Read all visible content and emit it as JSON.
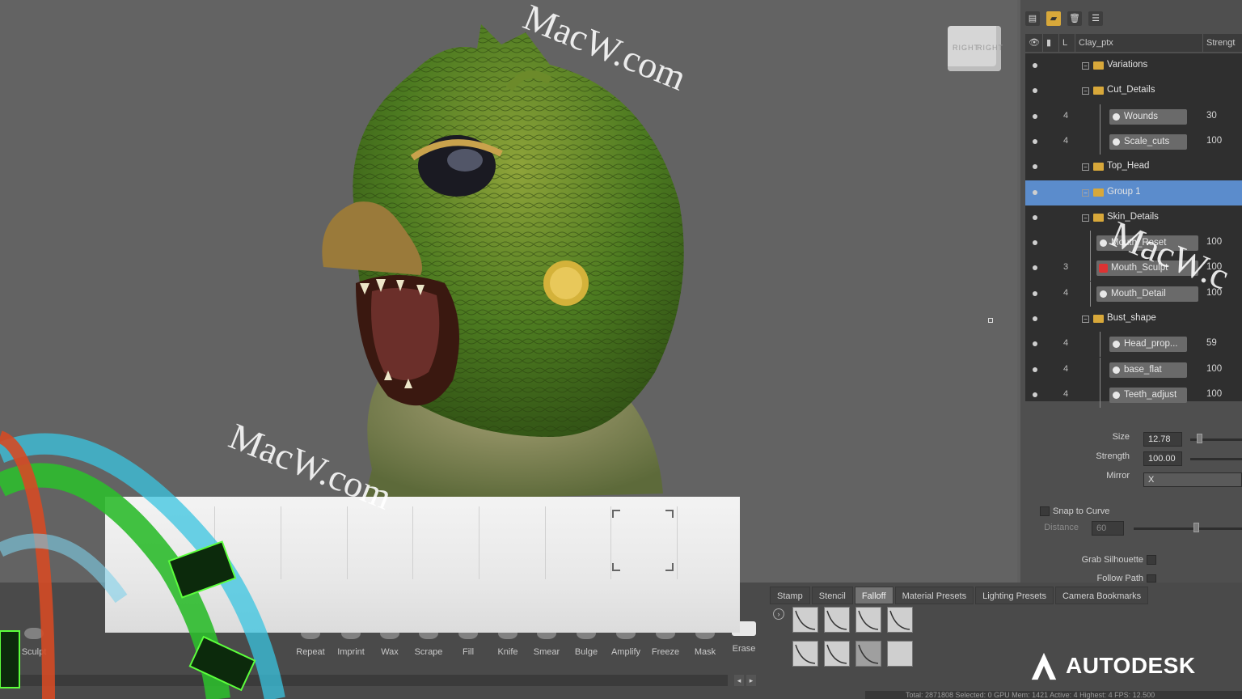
{
  "layer_panel": {
    "header": {
      "col_eye": "",
      "col_lock": "",
      "col_level": "L",
      "col_name": "Clay_ptx",
      "col_strength": "Strengt"
    },
    "rows": [
      {
        "type": "folder",
        "label": "Variations",
        "count": "",
        "strength": ""
      },
      {
        "type": "folder",
        "label": "Cut_Details",
        "count": "",
        "strength": ""
      },
      {
        "type": "layer",
        "label": "Wounds",
        "count": "4",
        "strength": "30"
      },
      {
        "type": "layer",
        "label": "Scale_cuts",
        "count": "4",
        "strength": "100"
      },
      {
        "type": "folder",
        "label": "Top_Head",
        "count": "",
        "strength": ""
      },
      {
        "type": "folder",
        "label": "Group 1",
        "count": "",
        "strength": "",
        "selected": true
      },
      {
        "type": "folder",
        "label": "Skin_Details",
        "count": "",
        "strength": ""
      },
      {
        "type": "layer",
        "label": "Mouth_Reset",
        "count": "",
        "strength": "100"
      },
      {
        "type": "layer",
        "label": "Mouth_Sculpt",
        "count": "3",
        "strength": "100",
        "color": "red"
      },
      {
        "type": "layer",
        "label": "Mouth_Detail",
        "count": "4",
        "strength": "100"
      },
      {
        "type": "folder",
        "label": "Bust_shape",
        "count": "",
        "strength": ""
      },
      {
        "type": "layer",
        "label": "Head_prop...",
        "count": "4",
        "strength": "59"
      },
      {
        "type": "layer",
        "label": "base_flat",
        "count": "4",
        "strength": "100"
      },
      {
        "type": "layer",
        "label": "Teeth_adjust",
        "count": "4",
        "strength": "100"
      }
    ]
  },
  "properties": {
    "size_label": "Size",
    "size_value": "12.78",
    "strength_label": "Strength",
    "strength_value": "100.00",
    "mirror_label": "Mirror",
    "mirror_value": "X",
    "snap_label": "Snap to Curve",
    "distance_label": "Distance",
    "distance_value": "60",
    "grab_label": "Grab Silhouette",
    "follow_label": "Follow Path"
  },
  "tray": {
    "tabs": [
      "Stamp",
      "Stencil",
      "Falloff",
      "Material Presets",
      "Lighting Presets",
      "Camera Bookmarks"
    ],
    "active_tab": "Falloff",
    "tools": [
      "Sculpt",
      "Repeat",
      "Imprint",
      "Wax",
      "Scrape",
      "Fill",
      "Knife",
      "Smear",
      "Bulge",
      "Amplify",
      "Freeze",
      "Mask",
      "Erase"
    ],
    "status": "Total: 2871808  Selected: 0  GPU Mem: 1421  Active: 4  Highest: 4  FPS: 12.500"
  },
  "viewport": {
    "cube_faces": [
      "RIGHT",
      "RIGHT"
    ]
  },
  "branding": {
    "logo_text": "AUTODESK"
  },
  "watermarks": [
    "MacW.com",
    "MacW.com",
    "MacW.c"
  ],
  "colors": {
    "selection": "#5b8ccc",
    "folder": "#d8a83a",
    "creature_green": "#4c7a20"
  }
}
